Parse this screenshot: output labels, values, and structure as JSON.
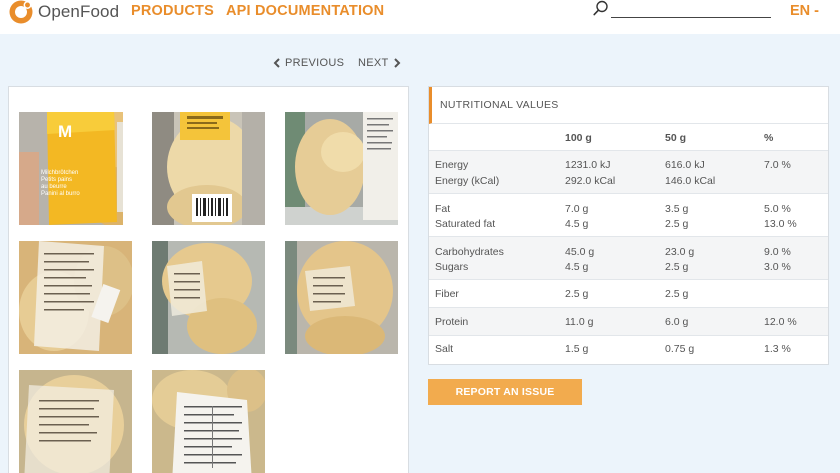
{
  "header": {
    "logo_text": "OpenFood",
    "nav": {
      "products": "PRODUCTS",
      "api": "API DOCUMENTATION"
    },
    "search": {
      "value": "",
      "placeholder": ""
    },
    "language": "EN -"
  },
  "pager": {
    "previous": "PREVIOUS",
    "next": "NEXT"
  },
  "colors": {
    "accent": "#e98d2b",
    "button": "#f2ab4e",
    "page_bg": "#ecf4fb"
  },
  "images": {
    "thumb1": {
      "brand": "M",
      "text_lines": [
        "Milchbrötchen",
        "Petits pains",
        "au beurre",
        "Panini al burro"
      ]
    }
  },
  "nutrition": {
    "title": "NUTRITIONAL VALUES",
    "columns": [
      "100 g",
      "50 g",
      "%"
    ],
    "groups": [
      {
        "rows": [
          {
            "name": "Energy",
            "per100": "1231.0 kJ",
            "per50": "616.0 kJ",
            "pct": "7.0 %"
          },
          {
            "name": "Energy (kCal)",
            "per100": "292.0 kCal",
            "per50": "146.0 kCal",
            "pct": ""
          }
        ]
      },
      {
        "rows": [
          {
            "name": "Fat",
            "per100": "7.0 g",
            "per50": "3.5 g",
            "pct": "5.0 %"
          },
          {
            "name": "Saturated fat",
            "per100": "4.5 g",
            "per50": "2.5 g",
            "pct": "13.0 %"
          }
        ]
      },
      {
        "rows": [
          {
            "name": "Carbohydrates",
            "per100": "45.0 g",
            "per50": "23.0 g",
            "pct": "9.0 %"
          },
          {
            "name": "Sugars",
            "per100": "4.5 g",
            "per50": "2.5 g",
            "pct": "3.0 %"
          }
        ]
      },
      {
        "rows": [
          {
            "name": "Fiber",
            "per100": "2.5 g",
            "per50": "2.5 g",
            "pct": ""
          }
        ]
      },
      {
        "rows": [
          {
            "name": "Protein",
            "per100": "11.0 g",
            "per50": "6.0 g",
            "pct": "12.0 %"
          }
        ]
      },
      {
        "rows": [
          {
            "name": "Salt",
            "per100": "1.5 g",
            "per50": "0.75 g",
            "pct": "1.3 %"
          }
        ]
      }
    ]
  },
  "report_button": "REPORT AN ISSUE"
}
